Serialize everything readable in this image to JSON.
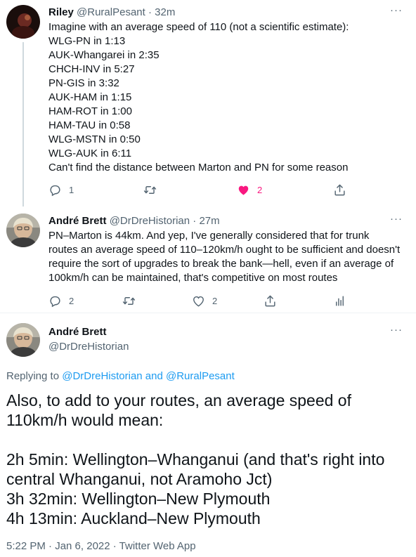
{
  "tweets": [
    {
      "name": "Riley",
      "handle": "@RuralPesant",
      "time": "· 32m",
      "lines": [
        "Imagine with an average speed of 110 (not a scientific estimate):",
        "WLG-PN in 1:13",
        "AUK-Whangarei in 2:35",
        "CHCH-INV in 5:27",
        "PN-GIS in 3:32",
        "AUK-HAM in 1:15",
        "HAM-ROT in 1:00",
        "HAM-TAU in 0:58",
        "WLG-MSTN in 0:50",
        "WLG-AUK in 6:11",
        "Can't find the distance between Marton and PN for some reason"
      ],
      "reply_count": "1",
      "retweet_count": "",
      "like_count": "2",
      "like_color": "#f91880"
    },
    {
      "name": "André Brett",
      "handle": "@DrDreHistorian",
      "time": "· 27m",
      "lines": [
        "PN–Marton is 44km. And yep, I've generally considered that for trunk",
        "routes an average speed of 110–120km/h ought to be sufficient and doesn't",
        "require the sort of upgrades to break the bank—hell, even if an average of",
        "100km/h can be maintained, that's competitive on most routes"
      ],
      "reply_count": "2",
      "retweet_count": "",
      "like_count": "2"
    }
  ],
  "main_tweet": {
    "name": "André Brett",
    "handle": "@DrDreHistorian",
    "replying_prefix": "Replying to",
    "replying_to": "@DrDreHistorian and @RuralPesant",
    "lines": [
      "Also, to add to your routes, an average speed of",
      "110km/h would mean:",
      "",
      "2h 5min: Wellington–Whanganui (and that's right into",
      "central Whanganui, not Aramoho Jct)",
      "3h 32min: Wellington–New Plymouth",
      "4h 13min: Auckland–New Plymouth"
    ],
    "timestamp": "5:22 PM · Jan 6, 2022 · Twitter Web App"
  },
  "icons": {
    "more": "more-dots-icon",
    "reply": "reply-icon",
    "retweet": "retweet-icon",
    "like": "heart-icon",
    "share": "share-icon",
    "analytics": "analytics-icon"
  },
  "colors": {
    "link": "#1d9bf0",
    "muted": "#536471",
    "like": "#f91880",
    "thread_line": "#cfd9de"
  }
}
